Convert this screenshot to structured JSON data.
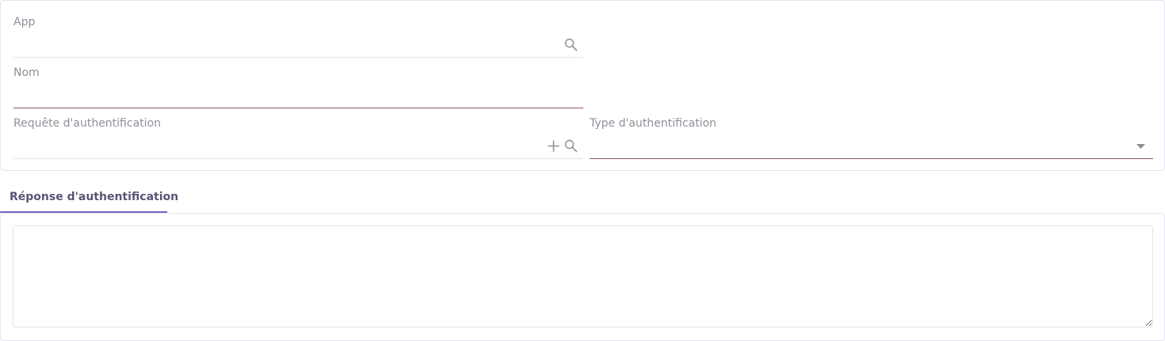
{
  "form": {
    "app": {
      "label": "App",
      "value": ""
    },
    "nom": {
      "label": "Nom",
      "value": ""
    },
    "requete": {
      "label": "Requête d'authentification",
      "value": ""
    },
    "type": {
      "label": "Type d'authentification",
      "value": ""
    }
  },
  "tabs": [
    {
      "label": "Réponse d'authentification",
      "active": true
    }
  ],
  "response": {
    "value": ""
  },
  "icons": {
    "search": "search-icon",
    "add": "plus-icon",
    "dropdown": "caret-down-icon"
  },
  "colors": {
    "accent": "#7b62c5",
    "required_line": "#8d5572",
    "label": "#8f8f99",
    "border": "#e6e4f0"
  }
}
